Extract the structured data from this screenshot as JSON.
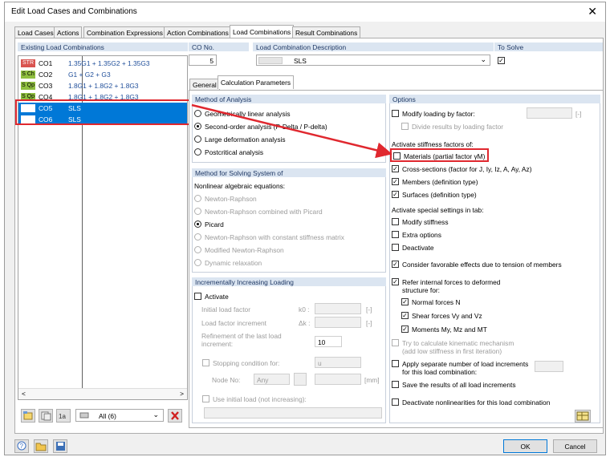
{
  "window": {
    "title": "Edit Load Cases and Combinations",
    "close": "✕"
  },
  "tabs": [
    "Load Cases",
    "Actions",
    "Combination Expressions",
    "Action Combinations",
    "Load Combinations",
    "Result Combinations"
  ],
  "left": {
    "header": "Existing Load Combinations",
    "rows": [
      {
        "badge": "STR",
        "badge_color": "#d9534f",
        "id": "CO1",
        "desc": "1.35G1 + 1.35G2 + 1.35G3"
      },
      {
        "badge": "S Ch",
        "badge_color": "#8fbf3f",
        "id": "CO2",
        "desc": "G1 + G2 + G3"
      },
      {
        "badge": "S Qp",
        "badge_color": "#8fbf3f",
        "id": "CO3",
        "desc": "1.8G1 + 1.8G2 + 1.8G3"
      },
      {
        "badge": "S Qp",
        "badge_color": "#8fbf3f",
        "id": "CO4",
        "desc": "1.8G1 + 1.8G2 + 1.8G3"
      },
      {
        "badge": "",
        "badge_color": "#ffffff",
        "id": "CO5",
        "desc": "SLS"
      },
      {
        "badge": "",
        "badge_color": "#ffffff",
        "id": "CO6",
        "desc": "SLS"
      }
    ],
    "filter": "All (6)",
    "scroll_left": "<",
    "scroll_right": ">"
  },
  "top": {
    "co_no_label": "CO No.",
    "co_no": "5",
    "desc_label": "Load Combination Description",
    "desc_value": "SLS",
    "to_solve_label": "To Solve",
    "to_solve_check": "✓"
  },
  "subtabs": [
    "General",
    "Calculation Parameters"
  ],
  "method": {
    "header": "Method of Analysis",
    "options": [
      "Geometrically linear analysis",
      "Second-order analysis (P-Delta / P-delta)",
      "Large deformation analysis",
      "Postcritical analysis"
    ]
  },
  "solving": {
    "header": "Method for Solving System of",
    "sub": "Nonlinear algebraic equations:",
    "options": [
      "Newton-Raphson",
      "Newton-Raphson combined with Picard",
      "Picard",
      "Newton-Raphson with constant stiffness matrix",
      "Modified Newton-Raphson",
      "Dynamic relaxation"
    ]
  },
  "incr": {
    "header": "Incrementally Increasing Loading",
    "activate": "Activate",
    "initial": "Initial load factor",
    "initial_sym": "k0 :",
    "increment": "Load factor increment",
    "increment_sym": "Δk :",
    "refinement": "Refinement of the last load increment:",
    "refinement_val": "10",
    "stopping": "Stopping condition for:",
    "stopping_val": "u",
    "node_no": "Node No:",
    "node_val": "Any",
    "mm": "[mm]",
    "unit": "[-]",
    "use_initial": "Use initial load (not increasing):"
  },
  "options": {
    "header": "Options",
    "modify": "Modify loading by factor:",
    "divide": "Divide results by loading factor",
    "unit": "[-]",
    "stiff_hdr": "Activate stiffness factors of:",
    "stiff": [
      "Materials (partial factor γM)",
      "Cross-sections (factor for J, Iy, Iz, A, Ay, Az)",
      "Members (definition type)",
      "Surfaces (definition type)"
    ],
    "special_hdr": "Activate special settings in tab:",
    "special": [
      "Modify stiffness",
      "Extra options",
      "Deactivate"
    ],
    "favorable": "Consider favorable effects due to tension of members",
    "refer1": "Refer internal forces to deformed",
    "refer2": "structure for:",
    "forces": [
      "Normal forces N",
      "Shear forces Vy and Vz",
      "Moments My, Mz and MT"
    ],
    "kinematic1": "Try to calculate kinematic mechanism",
    "kinematic2": "(add low stiffness in first iteration)",
    "separate1": "Apply separate number of load increments",
    "separate2": "for this load combination:",
    "save": "Save the results of all load increments",
    "deactivate_nl": "Deactivate nonlinearities for this load combination"
  },
  "footer": {
    "ok": "OK",
    "cancel": "Cancel"
  },
  "colors": {
    "accent": "#0078d7",
    "panel_header": "#dbe5f1",
    "highlight": "#e0282f"
  }
}
